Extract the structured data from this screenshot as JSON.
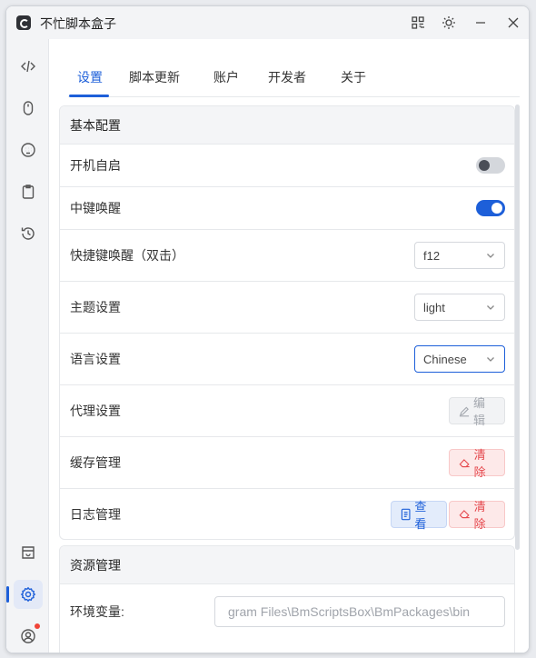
{
  "app": {
    "title": "不忙脚本盒子"
  },
  "tabs": [
    {
      "label": "设置",
      "active": true
    },
    {
      "label": "脚本更新"
    },
    {
      "label": "账户"
    },
    {
      "label": "开发者"
    },
    {
      "label": "关于"
    }
  ],
  "sidebar": {
    "top_icons": [
      "code-icon",
      "mouse-icon",
      "keyboard-icon",
      "clipboard-icon",
      "history-icon"
    ],
    "bottom_icons": [
      "store-icon",
      "settings-icon",
      "user-icon"
    ],
    "active_item": "settings-icon",
    "notification_on": "user-icon"
  },
  "basic_config": {
    "title": "基本配置",
    "autostart": {
      "label": "开机自启",
      "enabled": false
    },
    "middle_click": {
      "label": "中键唤醒",
      "enabled": true
    },
    "hotkey": {
      "label": "快捷键唤醒（双击）",
      "value": "f12"
    },
    "theme": {
      "label": "主题设置",
      "value": "light"
    },
    "language": {
      "label": "语言设置",
      "value": "Chinese"
    },
    "proxy": {
      "label": "代理设置",
      "button": "编辑"
    },
    "cache": {
      "label": "缓存管理",
      "button": "清除"
    },
    "logs": {
      "label": "日志管理",
      "view_button": "查看",
      "clear_button": "清除"
    }
  },
  "resources": {
    "title": "资源管理",
    "env": {
      "label": "环境变量:",
      "value": "gram Files\\BmScriptsBox\\BmPackages\\bin"
    }
  },
  "colors": {
    "accent": "#1d5fd9",
    "danger": "#e5484d",
    "badge": "#f04438"
  }
}
